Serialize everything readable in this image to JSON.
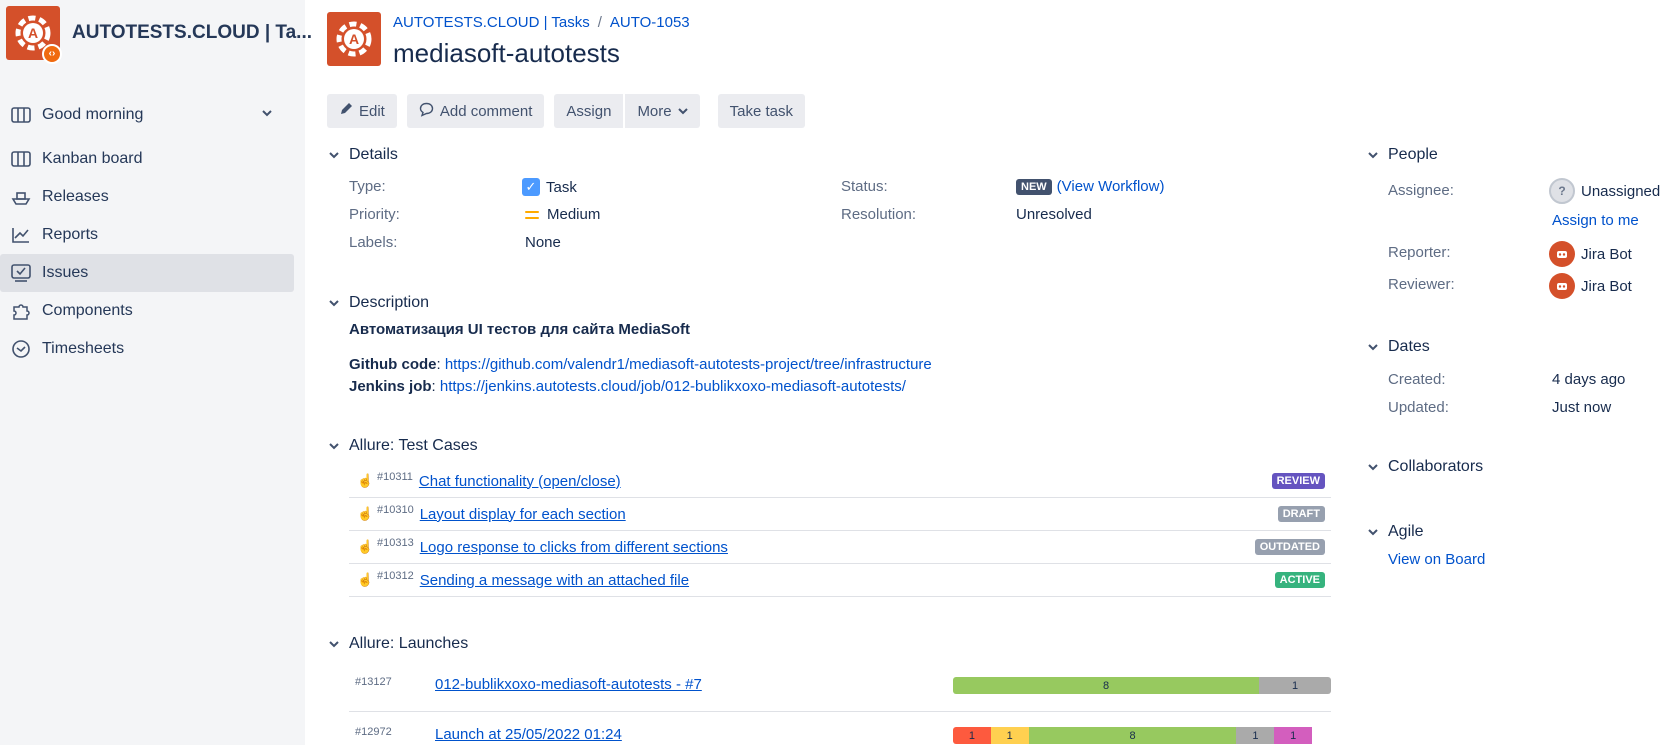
{
  "project": {
    "name": "AUTOTESTS.CLOUD | Ta...",
    "badge_icon": "code-icon"
  },
  "sidebar": {
    "items": [
      {
        "label": "Good morning",
        "icon": "board-icon"
      },
      {
        "label": "Kanban board",
        "icon": "kanban-icon"
      },
      {
        "label": "Releases",
        "icon": "ship-icon"
      },
      {
        "label": "Reports",
        "icon": "chart-icon"
      },
      {
        "label": "Issues",
        "icon": "issues-icon",
        "active": true
      },
      {
        "label": "Components",
        "icon": "puzzle-icon"
      },
      {
        "label": "Timesheets",
        "icon": "clock-icon"
      }
    ]
  },
  "header": {
    "breadcrumb": [
      "AUTOTESTS.CLOUD | Tasks",
      "AUTO-1053"
    ],
    "title": "mediasoft-autotests"
  },
  "toolbar": {
    "edit": "Edit",
    "add_comment": "Add comment",
    "assign": "Assign",
    "more": "More",
    "take_task": "Take task"
  },
  "details": {
    "title": "Details",
    "type_label": "Type:",
    "type_value": "Task",
    "priority_label": "Priority:",
    "priority_value": "Medium",
    "labels_label": "Labels:",
    "labels_value": "None",
    "status_label": "Status:",
    "status_value": "NEW",
    "workflow_link": "(View Workflow)",
    "resolution_label": "Resolution:",
    "resolution_value": "Unresolved"
  },
  "description": {
    "title": "Description",
    "heading": "Автоматизация UI тестов для сайта MediaSoft",
    "github_label": "Github code",
    "github_url": "https://github.com/valendr1/mediasoft-autotests-project/tree/infrastructure",
    "jenkins_label": "Jenkins job",
    "jenkins_url": "https://jenkins.autotests.cloud/job/012-bublikxoxo-mediasoft-autotests/"
  },
  "test_cases": {
    "title": "Allure: Test Cases",
    "items": [
      {
        "id": "#10311",
        "name": "Chat functionality (open/close)",
        "status": "REVIEW",
        "color": "#6554c0"
      },
      {
        "id": "#10310",
        "name": "Layout display for each section",
        "status": "DRAFT",
        "color": "#97a0af"
      },
      {
        "id": "#10313",
        "name": "Logo response to clicks from different sections",
        "status": "OUTDATED",
        "color": "#97a0af"
      },
      {
        "id": "#10312",
        "name": "Sending a message with an attached file",
        "status": "ACTIVE",
        "color": "#36b37e"
      }
    ]
  },
  "launches": {
    "title": "Allure: Launches",
    "items": [
      {
        "id": "#13127",
        "name": "012-bublikxoxo-mediasoft-autotests - #7",
        "segments": [
          {
            "value": "8",
            "color": "#97c95f",
            "fraction": 0.81
          },
          {
            "value": "1",
            "color": "#aaaaaa",
            "fraction": 0.19
          }
        ]
      },
      {
        "id": "#12972",
        "name": "Launch at 25/05/2022 01:24",
        "segments": [
          {
            "value": "1",
            "color": "#fd5a3e",
            "fraction": 0.1
          },
          {
            "value": "1",
            "color": "#ffd050",
            "fraction": 0.1
          },
          {
            "value": "8",
            "color": "#97c95f",
            "fraction": 0.55
          },
          {
            "value": "1",
            "color": "#aaaaaa",
            "fraction": 0.1
          },
          {
            "value": "1",
            "color": "#d35ebe",
            "fraction": 0.1
          }
        ]
      }
    ]
  },
  "people": {
    "title": "People",
    "assignee_label": "Assignee:",
    "assignee_value": "Unassigned",
    "assign_me": "Assign to me",
    "reporter_label": "Reporter:",
    "reporter_value": "Jira Bot",
    "reviewer_label": "Reviewer:",
    "reviewer_value": "Jira Bot"
  },
  "dates": {
    "title": "Dates",
    "created_label": "Created:",
    "created_value": "4 days ago",
    "updated_label": "Updated:",
    "updated_value": "Just now"
  },
  "collaborators": {
    "title": "Collaborators"
  },
  "agile": {
    "title": "Agile",
    "link": "View on Board"
  }
}
